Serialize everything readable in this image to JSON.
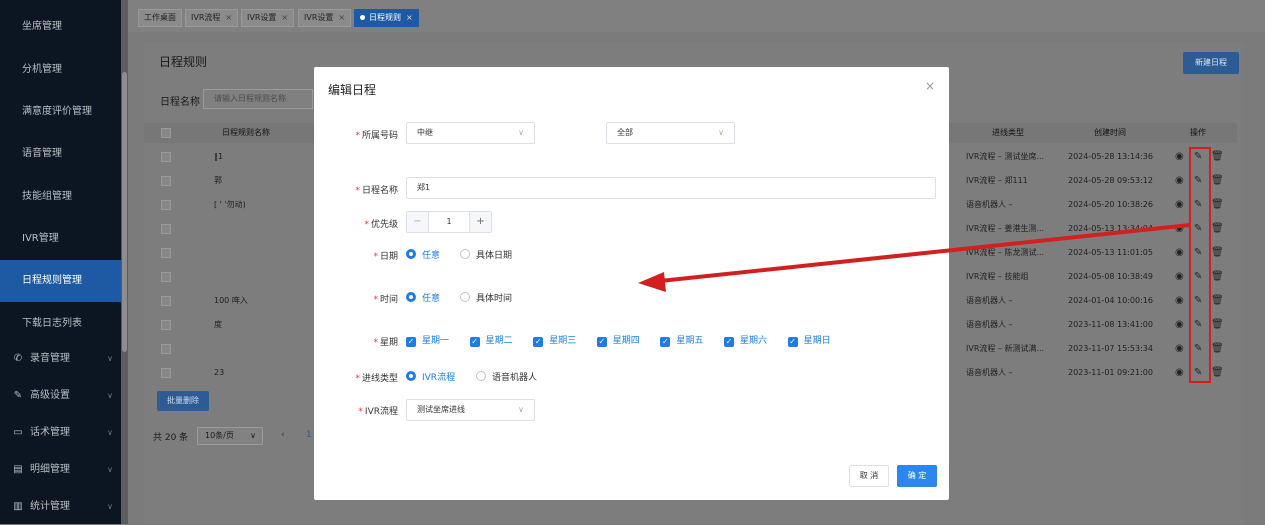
{
  "sidebar": {
    "items": [
      {
        "label": "坐席管理"
      },
      {
        "label": "分机管理"
      },
      {
        "label": "满意度评价管理"
      },
      {
        "label": "语音管理"
      },
      {
        "label": "技能组管理"
      },
      {
        "label": "IVR管理"
      },
      {
        "label": "日程规则管理"
      },
      {
        "label": "下载日志列表"
      }
    ],
    "groups": [
      {
        "label": "录音管理",
        "icon": "phone-icon"
      },
      {
        "label": "高级设置",
        "icon": "pen-icon"
      },
      {
        "label": "话术管理",
        "icon": "chat-icon"
      },
      {
        "label": "明细管理",
        "icon": "list-icon"
      },
      {
        "label": "统计管理",
        "icon": "chart-icon"
      }
    ]
  },
  "tabs": [
    {
      "label": "工作桌面"
    },
    {
      "label": "IVR流程"
    },
    {
      "label": "IVR设置"
    },
    {
      "label": "IVR设置"
    },
    {
      "label": "日程规则"
    }
  ],
  "page": {
    "title": "日程规则",
    "add_button": "新建日程",
    "filter_label": "日程名称",
    "filter_placeholder": "请输入日程规则名称",
    "batch_delete": "批量删除"
  },
  "table": {
    "headers": {
      "name": "日程规则名称",
      "type": "进线类型",
      "created": "创建时间",
      "ops": "操作"
    },
    "rows": [
      {
        "name": "‖1",
        "type": "IVR流程 – 测试坐席...",
        "created": "2024-05-28 13:14:36"
      },
      {
        "name": "郛",
        "type": "IVR流程 – 郑111",
        "created": "2024-05-28 09:53:12"
      },
      {
        "name": "[ ' '勿动)",
        "type": "语音机器人 –",
        "created": "2024-05-20 10:38:26"
      },
      {
        "name": "",
        "type": "IVR流程 – 姜港生测...",
        "created": "2024-05-13 13:34:04"
      },
      {
        "name": "",
        "type": "IVR流程 – 陈龙测试...",
        "created": "2024-05-13 11:01:05"
      },
      {
        "name": "",
        "type": "IVR流程 – 技能组",
        "created": "2024-05-08 10:38:49"
      },
      {
        "name": "100    哖入",
        "type": "语音机器人 –",
        "created": "2024-01-04 10:00:16"
      },
      {
        "name": "度",
        "type": "语音机器人 –",
        "created": "2023-11-08 13:41:00"
      },
      {
        "name": "",
        "type": "IVR流程 – 新测试满...",
        "created": "2023-11-07 15:53:34"
      },
      {
        "name": "23",
        "type": "语音机器人 –",
        "created": "2023-11-01 09:21:00"
      }
    ]
  },
  "pager": {
    "total": "共 20 条",
    "size": "10条/页",
    "prev": "‹",
    "page": "1"
  },
  "modal": {
    "title": "编辑日程",
    "close": "×",
    "number_label": "所属号码",
    "number_value": "中继",
    "number_sub_value": "全部",
    "name_label": "日程名称",
    "name_value": "郑1",
    "priority_label": "优先级",
    "priority_value": "1",
    "minus": "−",
    "plus": "+",
    "date_label": "日期",
    "date_opt_any": "任意",
    "date_opt_specific": "具体日期",
    "time_label": "时间",
    "time_opt_any": "任意",
    "time_opt_specific": "具体时间",
    "week_label": "星期",
    "weekdays": [
      "星期一",
      "星期二",
      "星期三",
      "星期四",
      "星期五",
      "星期六",
      "星期日"
    ],
    "line_type_label": "进线类型",
    "line_opt_ivr": "IVR流程",
    "line_opt_robot": "语音机器人",
    "ivr_label": "IVR流程",
    "ivr_value": "测试坐席进线",
    "cancel": "取 消",
    "confirm": "确 定"
  },
  "colors": {
    "accent": "#1e7be8",
    "annotation": "#d21f1f",
    "sidebar_active": "#1d5aa3"
  }
}
